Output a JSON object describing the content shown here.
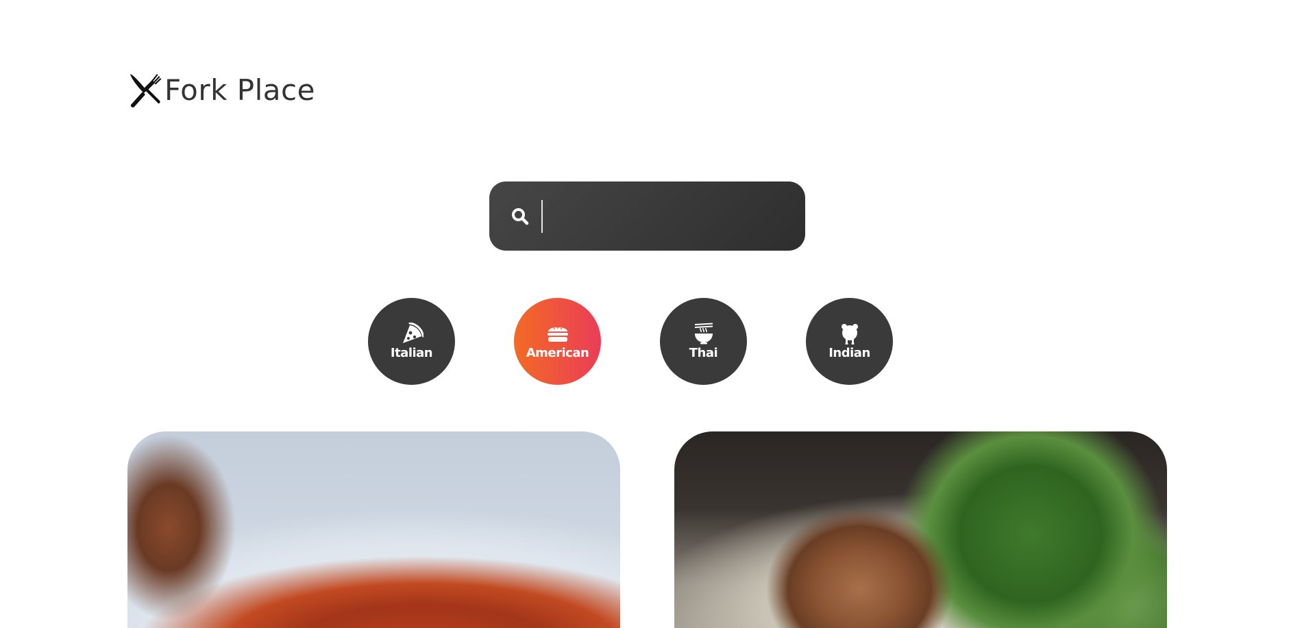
{
  "app": {
    "logo_text": "Fork Place",
    "logo_icon": "fork-knife-icon"
  },
  "search": {
    "icon": "search-icon",
    "value": "",
    "placeholder": ""
  },
  "categories": [
    {
      "label": "Italian",
      "icon": "pizza-icon",
      "active": false
    },
    {
      "label": "American",
      "icon": "burger-icon",
      "active": true
    },
    {
      "label": "Thai",
      "icon": "noodle-bowl-icon",
      "active": false
    },
    {
      "label": "Indian",
      "icon": "chicken-icon",
      "active": false
    }
  ],
  "colors": {
    "dark": "#3a3a3a",
    "accent_start": "#f36a24",
    "accent_end": "#ea3d58",
    "text": "#333333"
  },
  "cards": [
    {
      "image": "baked-beans-dish-photo"
    },
    {
      "image": "grilled-chicken-salad-photo"
    }
  ]
}
